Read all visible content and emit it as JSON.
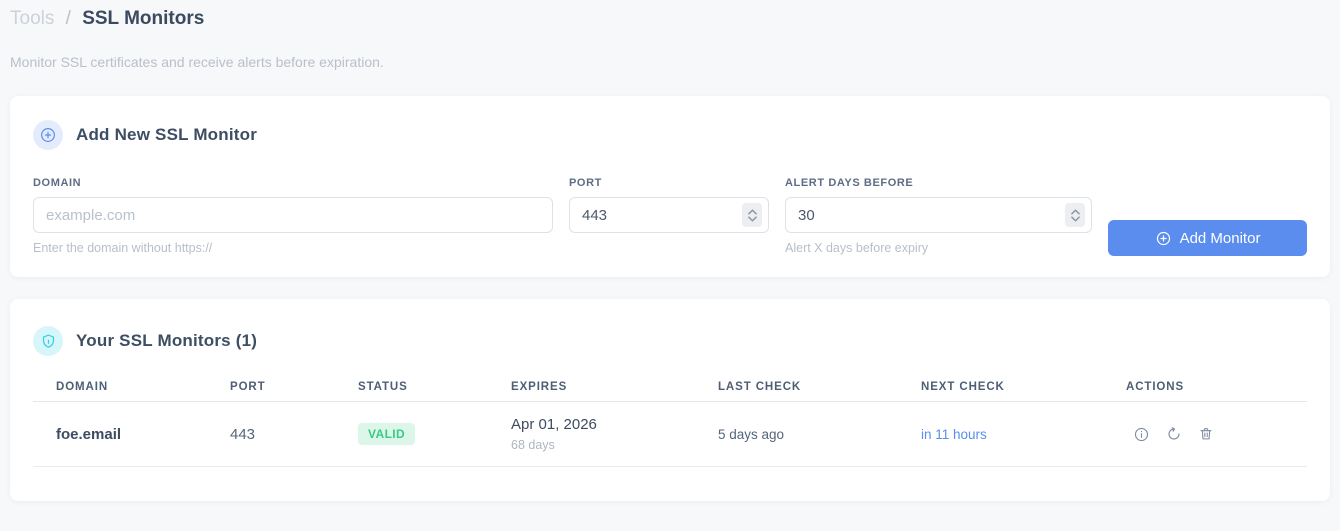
{
  "breadcrumb": {
    "section": "Tools",
    "separator": "/",
    "current": "SSL Monitors"
  },
  "subtitle": "Monitor SSL certificates and receive alerts before expiration.",
  "add_form": {
    "title": "Add New SSL Monitor",
    "fields": {
      "domain": {
        "label": "DOMAIN",
        "placeholder": "example.com",
        "helper": "Enter the domain without https://"
      },
      "port": {
        "label": "PORT",
        "value": "443"
      },
      "alert_days": {
        "label": "ALERT DAYS BEFORE",
        "value": "30",
        "helper": "Alert X days before expiry"
      }
    },
    "submit_label": "Add Monitor"
  },
  "monitors": {
    "title": "Your SSL Monitors (1)",
    "columns": [
      "DOMAIN",
      "PORT",
      "STATUS",
      "EXPIRES",
      "LAST CHECK",
      "NEXT CHECK",
      "ACTIONS"
    ],
    "rows": [
      {
        "domain": "foe.email",
        "port": "443",
        "status": "VALID",
        "expires_date": "Apr 01, 2026",
        "expires_days": "68 days",
        "last_check": "5 days ago",
        "next_check": "in 11 hours"
      }
    ]
  },
  "icons": {
    "add_badge": "plus-circle-icon",
    "list_badge": "shield-icon",
    "actions": [
      "info-icon",
      "refresh-icon",
      "trash-icon"
    ]
  },
  "colors": {
    "accent": "#5a8dee",
    "valid_bg": "#ddf6ea",
    "valid_text": "#38cb84",
    "shield_cyan": "#2bd2e4",
    "page_bg": "#f7f8f9"
  }
}
